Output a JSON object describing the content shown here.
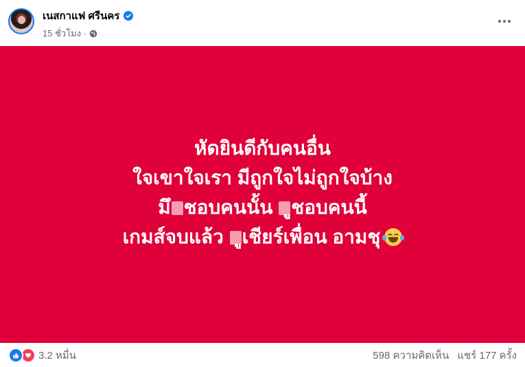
{
  "post": {
    "author_name": "เนสกาแฟ ศรีนคร",
    "timestamp": "15 ชั่วโมง",
    "separator": "·",
    "privacy_icon": "globe-icon",
    "verified_icon": "verified-badge-icon",
    "card_color": "#e0003a",
    "text_lines": {
      "line1": "หัดยินดีกับคนอื่น",
      "line2": "ใจเขาใจเรา มีถูกใจไม่ถูกใจบ้าง",
      "line3_a": "มึ",
      "line3_b": "ชอบคนนั้น ",
      "line3_c": "ูชอบคนนี้",
      "line4_a": "เกมส์จบแล้ว ",
      "line4_b": "ูเชียร์เพื่อน อามชุ"
    },
    "emoji": "face-with-tears-of-joy-icon"
  },
  "footer": {
    "reactions_count": "3.2 หมื่น",
    "reaction_icons": [
      "like-icon",
      "love-icon"
    ],
    "comments": "598 ความคิดเห็น",
    "shares": "แชร์ 177 ครั้ง"
  }
}
